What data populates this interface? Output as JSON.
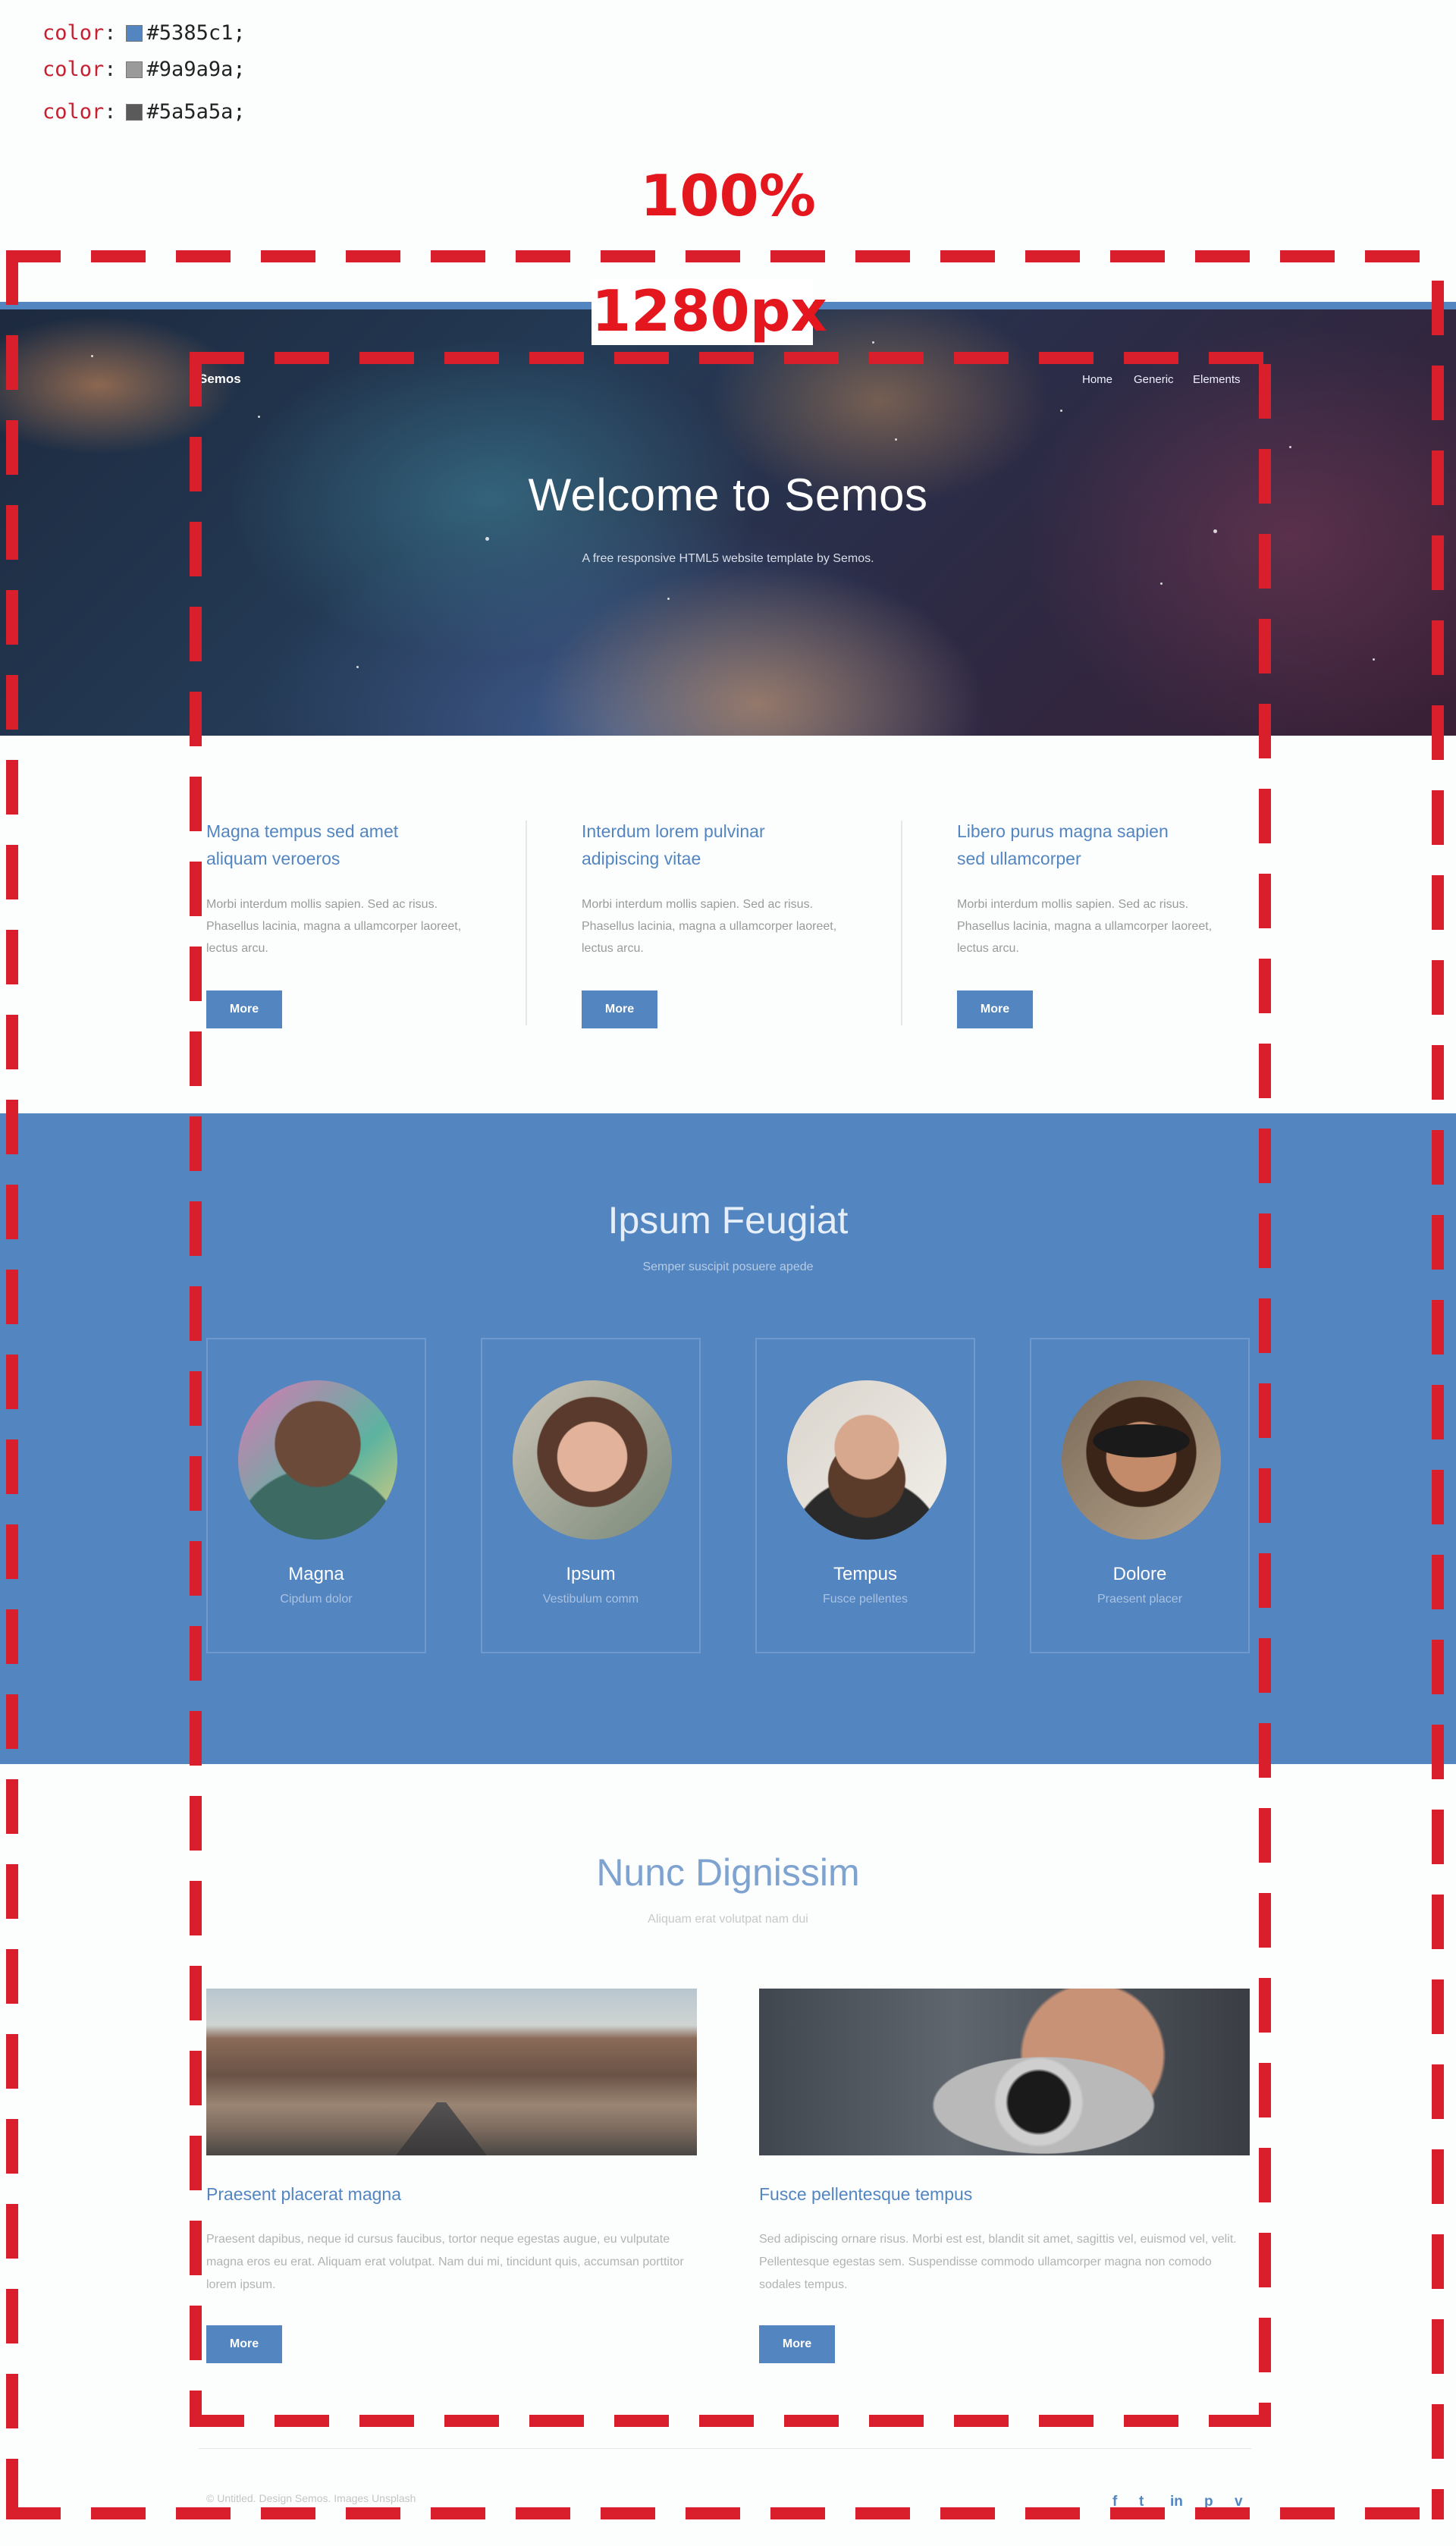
{
  "specs": [
    {
      "key": "color",
      "value": "#5385c1;",
      "swatch": "#5385c1"
    },
    {
      "key": "color",
      "value": "#9a9a9a;",
      "swatch": "#9a9a9a"
    },
    {
      "key": "color",
      "value": "#5a5a5a;",
      "swatch": "#5a5a5a"
    }
  ],
  "guides": {
    "outer_label": "100%",
    "inner_label": "1280px"
  },
  "header": {
    "brand": "Semos",
    "nav": [
      "Home",
      "Generic",
      "Elements"
    ]
  },
  "hero": {
    "title": "Welcome to Semos",
    "subtitle": "A free responsive HTML5 website template by Semos."
  },
  "features": [
    {
      "title": "Magna tempus sed amet aliquam veroeros",
      "body": "Morbi interdum mollis sapien. Sed ac risus. Phasellus lacinia, magna a ullamcorper laoreet, lectus arcu.",
      "button": "More"
    },
    {
      "title": "Interdum lorem pulvinar adipiscing vitae",
      "body": "Morbi interdum mollis sapien. Sed ac risus. Phasellus lacinia, magna a ullamcorper laoreet, lectus arcu.",
      "button": "More"
    },
    {
      "title": "Libero purus magna sapien sed ullamcorper",
      "body": "Morbi interdum mollis sapien. Sed ac risus. Phasellus lacinia, magna a ullamcorper laoreet, lectus arcu.",
      "button": "More"
    }
  ],
  "team": {
    "title": "Ipsum Feugiat",
    "subtitle": "Semper suscipit posuere apede",
    "members": [
      {
        "name": "Magna",
        "role": "Cipdum dolor"
      },
      {
        "name": "Ipsum",
        "role": "Vestibulum comm"
      },
      {
        "name": "Tempus",
        "role": "Fusce pellentes"
      },
      {
        "name": "Dolore",
        "role": "Praesent placer"
      }
    ]
  },
  "posts_section": {
    "title": "Nunc Dignissim",
    "subtitle": "Aliquam erat volutpat nam dui"
  },
  "posts": [
    {
      "title": "Praesent placerat magna",
      "body": "Praesent dapibus, neque id cursus faucibus, tortor neque egestas augue, eu vulputate magna eros eu erat. Aliquam erat volutpat. Nam dui mi, tincidunt quis, accumsan porttitor lorem ipsum.",
      "button": "More"
    },
    {
      "title": "Fusce pellentesque tempus",
      "body": "Sed adipiscing ornare risus. Morbi est est, blandit sit amet, sagittis vel, euismod vel, velit. Pellentesque egestas sem. Suspendisse commodo ullamcorper magna non comodo sodales tempus.",
      "button": "More"
    }
  ],
  "footer": {
    "copyright": "© Untitled. Design Semos. Images Unsplash",
    "social": [
      "f",
      "t",
      "in",
      "p",
      "v"
    ]
  },
  "colors": {
    "accent": "#5385c1",
    "muted": "#9a9a9a",
    "text": "#5a5a5a",
    "guide": "#d91f2c"
  }
}
